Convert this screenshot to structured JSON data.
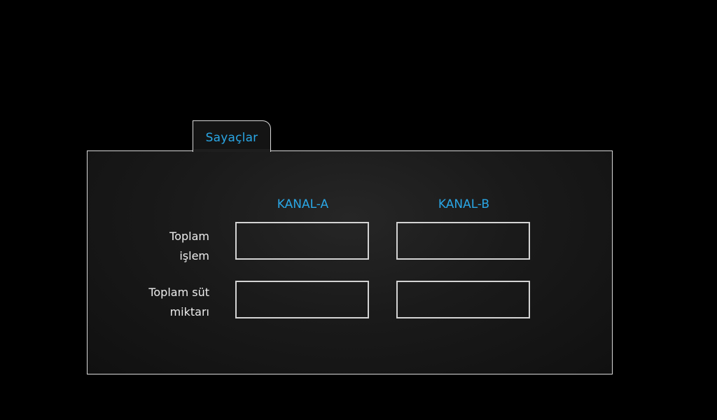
{
  "tab": {
    "label": "Sayaçlar"
  },
  "columns": {
    "a": "KANAL-A",
    "b": "KANAL-B"
  },
  "rows": [
    {
      "line1": "Toplam",
      "line2": "işlem"
    },
    {
      "line1": "Toplam süt",
      "line2": "miktarı"
    }
  ],
  "fields": {
    "total_ops_a": "",
    "total_ops_b": "",
    "total_milk_a": "",
    "total_milk_b": ""
  },
  "colors": {
    "accent": "#2aa7e6",
    "border": "#d9d9d9",
    "background": "#000000"
  }
}
